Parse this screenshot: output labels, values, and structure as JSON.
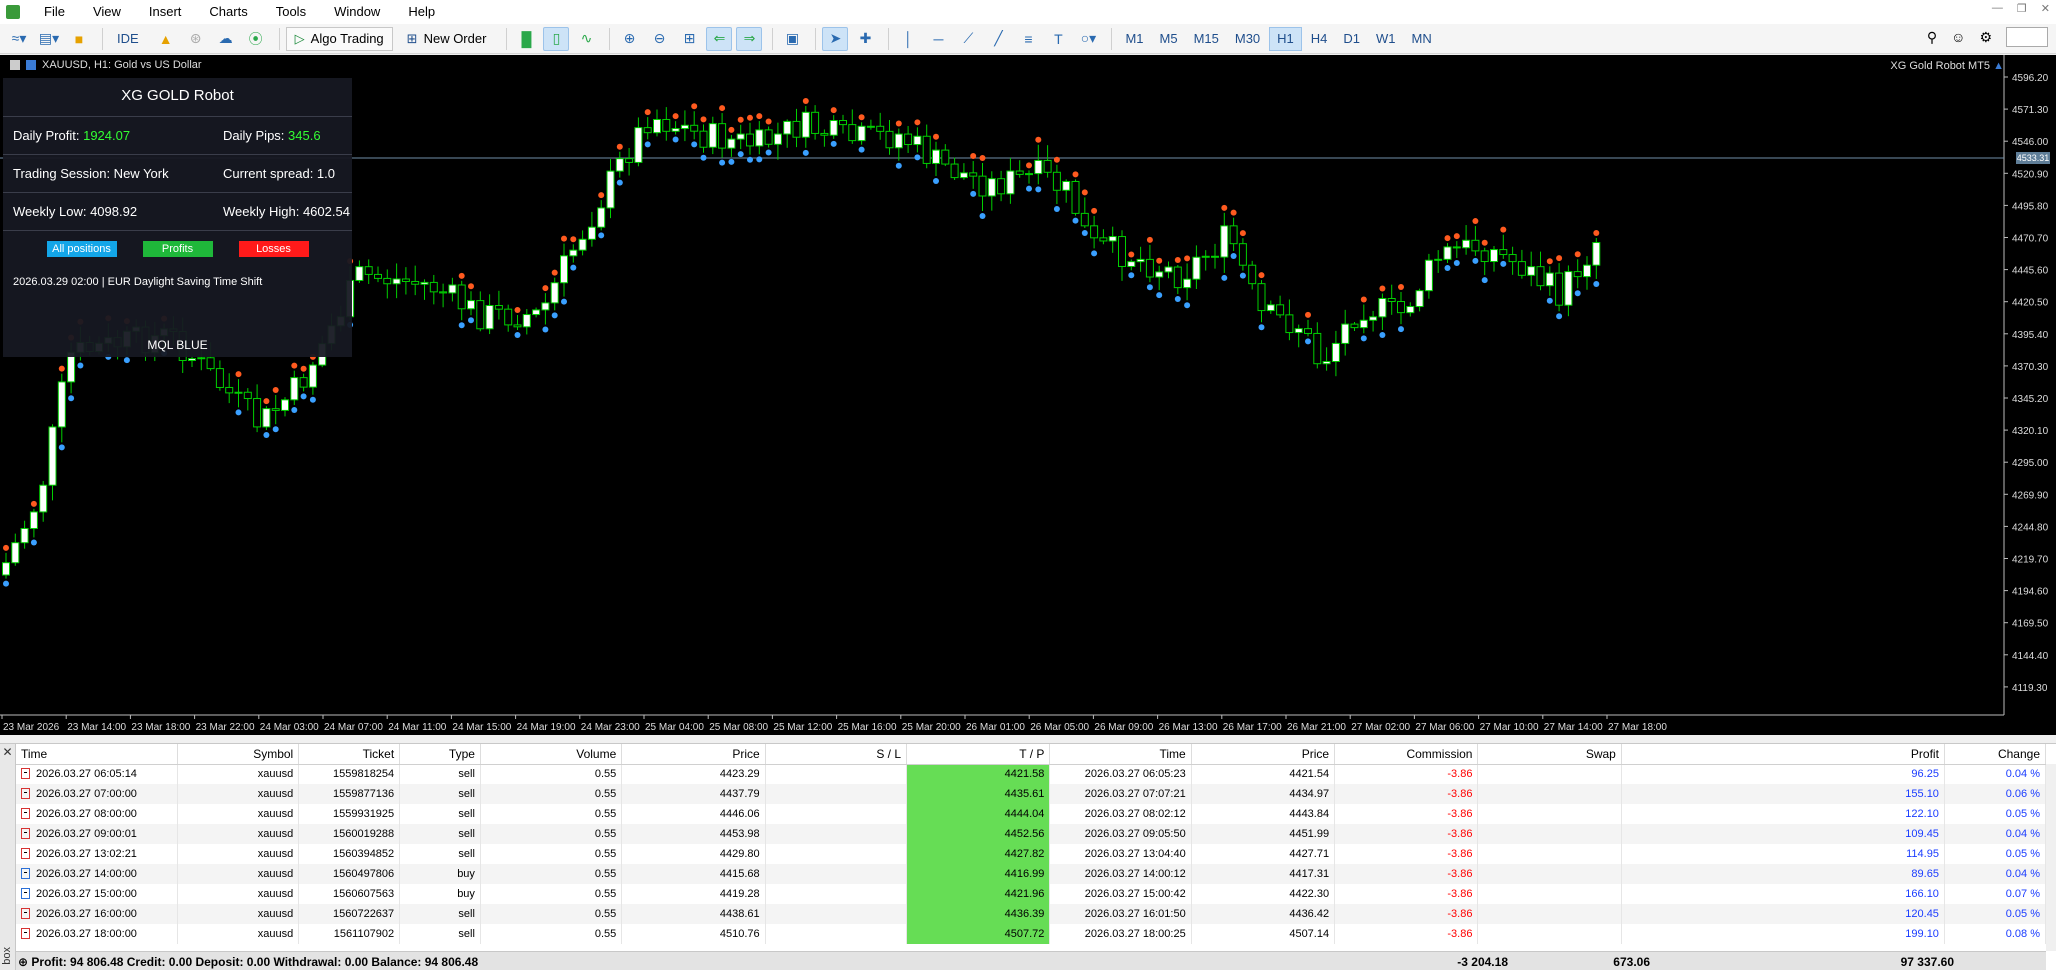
{
  "menu": [
    "File",
    "View",
    "Insert",
    "Charts",
    "Tools",
    "Window",
    "Help"
  ],
  "toolbar": {
    "ide_label": "IDE",
    "algo_trading_label": "Algo Trading",
    "new_order_label": "New Order",
    "timeframes": [
      "M1",
      "M5",
      "M15",
      "M30",
      "H1",
      "H4",
      "D1",
      "W1",
      "MN"
    ],
    "active_timeframe": "H1"
  },
  "chart": {
    "title": "XAUUSD, H1:  Gold vs US Dollar",
    "ea_name": "XG Gold Robot MT5",
    "current_price_tag": "4533.31",
    "price_labels": [
      "4596.20",
      "4571.30",
      "4546.00",
      "4520.90",
      "4495.80",
      "4470.70",
      "4445.60",
      "4420.50",
      "4395.40",
      "4370.30",
      "4345.20",
      "4320.10",
      "4295.00",
      "4269.90",
      "4244.80",
      "4219.70",
      "4194.60",
      "4169.50",
      "4144.40",
      "4119.30"
    ],
    "time_labels": [
      "23 Mar 2026",
      "23 Mar 14:00",
      "23 Mar 18:00",
      "23 Mar 22:00",
      "24 Mar 03:00",
      "24 Mar 07:00",
      "24 Mar 11:00",
      "24 Mar 15:00",
      "24 Mar 19:00",
      "24 Mar 23:00",
      "25 Mar 04:00",
      "25 Mar 08:00",
      "25 Mar 12:00",
      "25 Mar 16:00",
      "25 Mar 20:00",
      "26 Mar 01:00",
      "26 Mar 05:00",
      "26 Mar 09:00",
      "26 Mar 13:00",
      "26 Mar 17:00",
      "26 Mar 21:00",
      "27 Mar 02:00",
      "27 Mar 06:00",
      "27 Mar 10:00",
      "27 Mar 14:00",
      "27 Mar 18:00"
    ],
    "colors": {
      "background": "#000000",
      "bull_body": "#ffffff",
      "wick": "#00d000",
      "bid_line": "#6f8ea8"
    }
  },
  "robot_panel": {
    "title": "XG GOLD Robot",
    "daily_profit_label": "Daily Profit:",
    "daily_profit_value": "1924.07",
    "daily_pips_label": "Daily Pips:",
    "daily_pips_value": "345.6",
    "session_label": "Trading Session: New York",
    "spread_label": "Current spread: 1.0",
    "weekly_low_label": "Weekly Low: 4098.92",
    "weekly_high_label": "Weekly High: 4602.54",
    "btn_all": "All positions",
    "btn_profits": "Profits",
    "btn_losses": "Losses",
    "news_line": "2026.03.29 02:00  |  EUR     Daylight Saving Time Shift",
    "footer": "MQL BLUE"
  },
  "table": {
    "columns": [
      "Time",
      "Symbol",
      "Ticket",
      "Type",
      "Volume",
      "Price",
      "S / L",
      "T / P",
      "Time",
      "Price",
      "Commission",
      "Swap",
      "Profit",
      "Change"
    ],
    "rows": [
      {
        "open_time": "2026.03.27 06:05:14",
        "symbol": "xauusd",
        "ticket": "1559818254",
        "type": "sell",
        "volume": "0.55",
        "price": "4423.29",
        "sl": "",
        "tp": "4421.58",
        "close_time": "2026.03.27 06:05:23",
        "close_price": "4421.54",
        "commission": "-3.86",
        "swap": "",
        "profit": "96.25",
        "change": "0.04 %"
      },
      {
        "open_time": "2026.03.27 07:00:00",
        "symbol": "xauusd",
        "ticket": "1559877136",
        "type": "sell",
        "volume": "0.55",
        "price": "4437.79",
        "sl": "",
        "tp": "4435.61",
        "close_time": "2026.03.27 07:07:21",
        "close_price": "4434.97",
        "commission": "-3.86",
        "swap": "",
        "profit": "155.10",
        "change": "0.06 %"
      },
      {
        "open_time": "2026.03.27 08:00:00",
        "symbol": "xauusd",
        "ticket": "1559931925",
        "type": "sell",
        "volume": "0.55",
        "price": "4446.06",
        "sl": "",
        "tp": "4444.04",
        "close_time": "2026.03.27 08:02:12",
        "close_price": "4443.84",
        "commission": "-3.86",
        "swap": "",
        "profit": "122.10",
        "change": "0.05 %"
      },
      {
        "open_time": "2026.03.27 09:00:01",
        "symbol": "xauusd",
        "ticket": "1560019288",
        "type": "sell",
        "volume": "0.55",
        "price": "4453.98",
        "sl": "",
        "tp": "4452.56",
        "close_time": "2026.03.27 09:05:50",
        "close_price": "4451.99",
        "commission": "-3.86",
        "swap": "",
        "profit": "109.45",
        "change": "0.04 %"
      },
      {
        "open_time": "2026.03.27 13:02:21",
        "symbol": "xauusd",
        "ticket": "1560394852",
        "type": "sell",
        "volume": "0.55",
        "price": "4429.80",
        "sl": "",
        "tp": "4427.82",
        "close_time": "2026.03.27 13:04:40",
        "close_price": "4427.71",
        "commission": "-3.86",
        "swap": "",
        "profit": "114.95",
        "change": "0.05 %"
      },
      {
        "open_time": "2026.03.27 14:00:00",
        "symbol": "xauusd",
        "ticket": "1560497806",
        "type": "buy",
        "volume": "0.55",
        "price": "4415.68",
        "sl": "",
        "tp": "4416.99",
        "close_time": "2026.03.27 14:00:12",
        "close_price": "4417.31",
        "commission": "-3.86",
        "swap": "",
        "profit": "89.65",
        "change": "0.04 %"
      },
      {
        "open_time": "2026.03.27 15:00:00",
        "symbol": "xauusd",
        "ticket": "1560607563",
        "type": "buy",
        "volume": "0.55",
        "price": "4419.28",
        "sl": "",
        "tp": "4421.96",
        "close_time": "2026.03.27 15:00:42",
        "close_price": "4422.30",
        "commission": "-3.86",
        "swap": "",
        "profit": "166.10",
        "change": "0.07 %"
      },
      {
        "open_time": "2026.03.27 16:00:00",
        "symbol": "xauusd",
        "ticket": "1560722637",
        "type": "sell",
        "volume": "0.55",
        "price": "4438.61",
        "sl": "",
        "tp": "4436.39",
        "close_time": "2026.03.27 16:01:50",
        "close_price": "4436.42",
        "commission": "-3.86",
        "swap": "",
        "profit": "120.45",
        "change": "0.05 %"
      },
      {
        "open_time": "2026.03.27 18:00:00",
        "symbol": "xauusd",
        "ticket": "1561107902",
        "type": "sell",
        "volume": "0.55",
        "price": "4510.76",
        "sl": "",
        "tp": "4507.72",
        "close_time": "2026.03.27 18:00:25",
        "close_price": "4507.14",
        "commission": "-3.86",
        "swap": "",
        "profit": "199.10",
        "change": "0.08 %"
      }
    ],
    "summary": {
      "text": "Profit: 94 806.48  Credit: 0.00  Deposit: 0.00  Withdrawal: 0.00  Balance: 94 806.48",
      "commission_total": "-3 204.18",
      "swap_total": "673.06",
      "profit_total": "97 337.60"
    },
    "side_label": "box"
  }
}
